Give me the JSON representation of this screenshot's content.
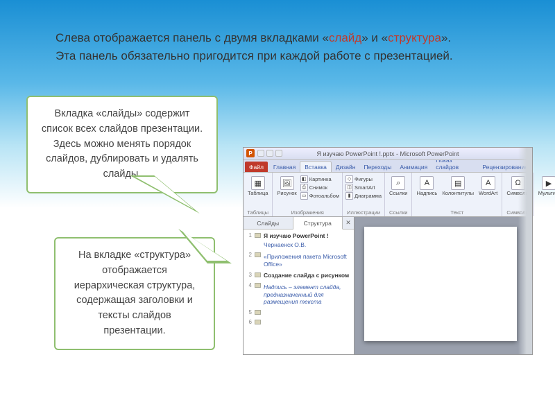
{
  "header": {
    "line1_pre": "Слева отображается панель с двумя вкладками «",
    "line1_hl1": "слайд",
    "line1_mid": "» и «",
    "line1_hl2": "структура",
    "line1_post": "».",
    "line2": "Эта панель обязательно пригодится при каждой работе с презентацией."
  },
  "callout1": "Вкладка «слайды» содержит список всех слайдов презентации. Здесь можно менять порядок слайдов, дублировать и удалять слайды.",
  "callout2": "На вкладке «структура» отображается иерархическая структура, содержащая заголовки и тексты слайдов презентации.",
  "screenshot": {
    "titlebar": "Я изучаю PowerPoint !.pptx - Microsoft PowerPoint",
    "pp_letter": "P",
    "ribbon_tabs": {
      "file": "Файл",
      "home": "Главная",
      "insert": "Вставка",
      "design": "Дизайн",
      "transitions": "Переходы",
      "animations": "Анимация",
      "slideshow": "Показ слайдов",
      "review": "Рецензирование"
    },
    "ribbon_groups": {
      "tables": {
        "label": "Таблицы",
        "btn_table": "Таблица"
      },
      "images": {
        "label": "Изображения",
        "btn_picture": "Рисунок",
        "btn_clipart": "Картинка",
        "btn_screenshot": "Снимок",
        "btn_album": "Фотоальбом"
      },
      "illustrations": {
        "label": "Иллюстрации",
        "btn_shapes": "Фигуры",
        "btn_smartart": "SmartArt",
        "btn_chart": "Диаграмма"
      },
      "links": {
        "label": "Ссылки",
        "btn_link": "Ссылки"
      },
      "text": {
        "label": "Текст",
        "btn_textbox_top": "A",
        "btn_textbox": "Надпись",
        "btn_headerfooter": "Колонтитулы",
        "btn_wordart": "WordArt"
      },
      "symbols": {
        "label": "Символы",
        "btn_symbol": "Символы"
      },
      "media": {
        "label": "",
        "btn_media": "Мультим"
      }
    },
    "leftpane": {
      "tab_slides": "Слайды",
      "tab_structure": "Структура",
      "close": "✕",
      "outline": [
        {
          "n": "1",
          "title": "Я изучаю PowerPoint !",
          "sub": "Чернаенск О.В."
        },
        {
          "n": "2",
          "title": "",
          "sub": "«Приложения пакета Microsoft Office»"
        },
        {
          "n": "3",
          "title": "Создание слайда с рисунком",
          "sub": ""
        },
        {
          "n": "4",
          "title": "",
          "sub": "Надпись – элемент слайда, предназначенный для размещения текста"
        },
        {
          "n": "5",
          "title": "",
          "sub": ""
        },
        {
          "n": "6",
          "title": "",
          "sub": ""
        }
      ]
    }
  }
}
